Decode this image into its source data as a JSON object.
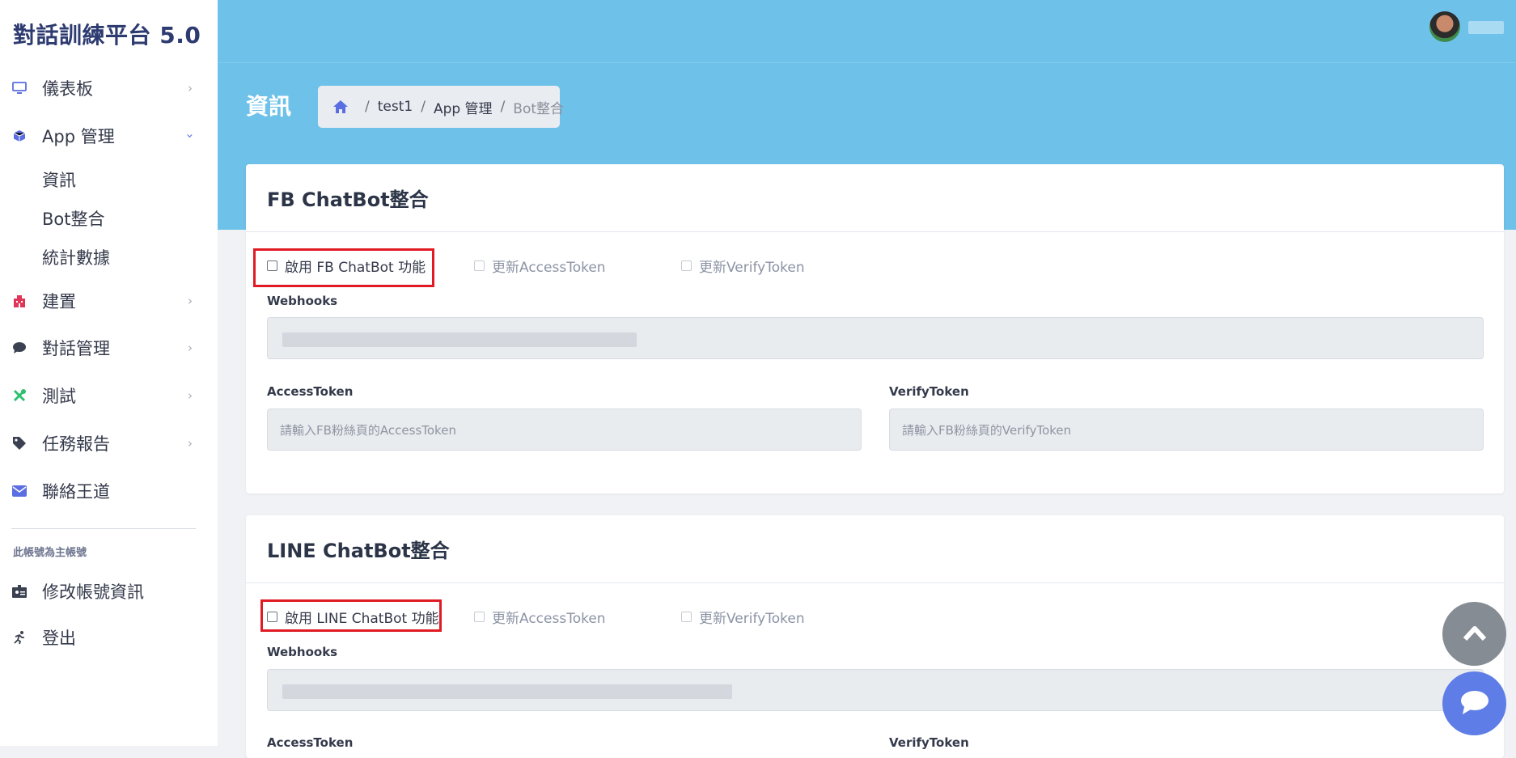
{
  "brand": {
    "title": "對話訓練平台 5.0"
  },
  "sidebar": {
    "items": [
      {
        "label": "儀表板",
        "icon": "monitor-icon"
      },
      {
        "label": "App 管理",
        "icon": "cube-icon"
      },
      {
        "label": "建置",
        "icon": "building-icon"
      },
      {
        "label": "對話管理",
        "icon": "chat-bubble-icon"
      },
      {
        "label": "測試",
        "icon": "tools-icon"
      },
      {
        "label": "任務報告",
        "icon": "tag-icon"
      },
      {
        "label": "聯絡王道",
        "icon": "envelope-icon"
      }
    ],
    "sub_items": [
      "資訊",
      "Bot整合",
      "統計數據"
    ],
    "account_note": "此帳號為主帳號",
    "account_items": [
      {
        "label": "修改帳號資訊",
        "icon": "id-card-icon"
      },
      {
        "label": "登出",
        "icon": "running-icon"
      }
    ]
  },
  "header": {
    "page_title": "資訊"
  },
  "breadcrumb": {
    "items": [
      "test1",
      "App 管理",
      "Bot整合"
    ],
    "separator": "/"
  },
  "fb_card": {
    "title": "FB ChatBot整合",
    "enable_label": "啟用 FB ChatBot 功能",
    "update_access_label": "更新AccessToken",
    "update_verify_label": "更新VerifyToken",
    "webhooks_label": "Webhooks",
    "access_token_label": "AccessToken",
    "verify_token_label": "VerifyToken",
    "access_token_placeholder": "請輸入FB粉絲頁的AccessToken",
    "verify_token_placeholder": "請輸入FB粉絲頁的VerifyToken"
  },
  "line_card": {
    "title": "LINE ChatBot整合",
    "enable_label": "啟用 LINE ChatBot 功能",
    "update_access_label": "更新AccessToken",
    "update_verify_label": "更新VerifyToken",
    "webhooks_label": "Webhooks",
    "access_token_label": "AccessToken",
    "verify_token_label": "VerifyToken"
  },
  "colors": {
    "header_bg": "#6ec1e8",
    "brand": "#2d3b71",
    "highlight": "#e01b24",
    "chat_button": "#5f7de6"
  }
}
